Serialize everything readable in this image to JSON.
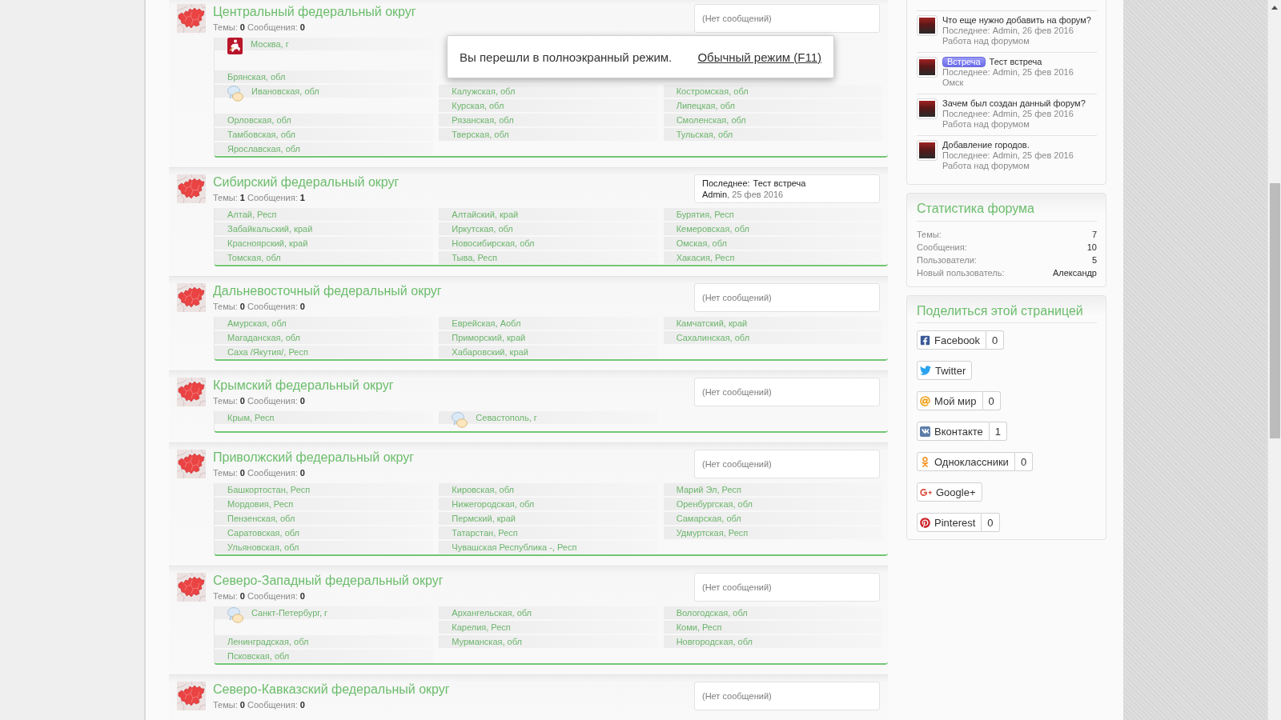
{
  "fullscreen_notice": {
    "text": "Вы перешли в полноэкранный режим.",
    "link": "Обычный режим (F11)"
  },
  "forums": [
    {
      "title": "Центральный федеральный округ",
      "stats": "Темы: **0** Сообщения: **0**",
      "last_post": {
        "kind": "empty",
        "text": "(Нет сообщений)"
      },
      "subforums": [
        {
          "kind": "coat",
          "name": "Москва, г"
        },
        {
          "kind": "covered"
        },
        {
          "kind": "covered"
        },
        {
          "kind": "covered"
        },
        {
          "kind": "covered"
        },
        {
          "kind": "plain",
          "name": "Брянская, обл"
        },
        {
          "kind": "covered"
        },
        {
          "kind": "covered"
        },
        {
          "kind": "bubble",
          "name": "Ивановская, обл"
        },
        {
          "kind": "plain",
          "name": "Калужская, обл"
        },
        {
          "kind": "plain",
          "name": "Костромская, обл"
        },
        {
          "kind": "plain",
          "name": "Курская, обл"
        },
        {
          "kind": "plain",
          "name": "Липецкая, обл"
        },
        {
          "kind": "plain",
          "name": "Орловская, обл"
        },
        {
          "kind": "plain",
          "name": "Рязанская, обл"
        },
        {
          "kind": "plain",
          "name": "Смоленская, обл"
        },
        {
          "kind": "plain",
          "name": "Тамбовская, обл"
        },
        {
          "kind": "plain",
          "name": "Тверская, обл"
        },
        {
          "kind": "plain",
          "name": "Тульская, обл"
        },
        {
          "kind": "plain",
          "name": "Ярославская, обл"
        }
      ]
    },
    {
      "title": "Сибирский федеральный округ",
      "stats": "Темы: **1** Сообщения: **1**",
      "last_post": {
        "kind": "post",
        "label": "Последнее:",
        "topic": "Тест встреча",
        "author": "Admin",
        "date": ", 25 фев 2016"
      },
      "subforums": [
        {
          "kind": "plain",
          "name": "Алтай, Респ"
        },
        {
          "kind": "plain",
          "name": "Алтайский, край"
        },
        {
          "kind": "plain",
          "name": "Бурятия, Респ"
        },
        {
          "kind": "plain",
          "name": "Забайкальский, край"
        },
        {
          "kind": "plain",
          "name": "Иркутская, обл"
        },
        {
          "kind": "plain",
          "name": "Кемеровская, обл"
        },
        {
          "kind": "plain",
          "name": "Красноярский, край"
        },
        {
          "kind": "plain",
          "name": "Новосибирская, обл"
        },
        {
          "kind": "plain",
          "name": "Омская, обл"
        },
        {
          "kind": "plain",
          "name": "Томская, обл"
        },
        {
          "kind": "plain",
          "name": "Тыва, Респ"
        },
        {
          "kind": "plain",
          "name": "Хакасия, Респ"
        }
      ]
    },
    {
      "title": "Дальневосточный федеральный округ",
      "stats": "Темы: **0** Сообщения: **0**",
      "last_post": {
        "kind": "empty",
        "text": "(Нет сообщений)"
      },
      "subforums": [
        {
          "kind": "plain",
          "name": "Амурская, обл"
        },
        {
          "kind": "plain",
          "name": "Еврейская, Аобл"
        },
        {
          "kind": "plain",
          "name": "Камчатский, край"
        },
        {
          "kind": "plain",
          "name": "Магаданская, обл"
        },
        {
          "kind": "plain",
          "name": "Приморский, край"
        },
        {
          "kind": "plain",
          "name": "Сахалинская, обл"
        },
        {
          "kind": "plain",
          "name": "Саха /Якутия/, Респ"
        },
        {
          "kind": "plain",
          "name": "Хабаровский, край"
        }
      ]
    },
    {
      "title": "Крымский федеральный округ",
      "stats": "Темы: **0** Сообщения: **0**",
      "last_post": {
        "kind": "empty",
        "text": "(Нет сообщений)"
      },
      "subforums": [
        {
          "kind": "plain",
          "name": "Крым, Респ"
        },
        {
          "kind": "bubble",
          "name": "Севастополь, г"
        }
      ]
    },
    {
      "title": "Приволжский федеральный округ",
      "stats": "Темы: **0** Сообщения: **0**",
      "last_post": {
        "kind": "empty",
        "text": "(Нет сообщений)"
      },
      "subforums": [
        {
          "kind": "plain",
          "name": "Башкортостан, Респ"
        },
        {
          "kind": "plain",
          "name": "Кировская, обл"
        },
        {
          "kind": "plain",
          "name": "Марий Эл, Респ"
        },
        {
          "kind": "plain",
          "name": "Мордовия, Респ"
        },
        {
          "kind": "plain",
          "name": "Нижегородская, обл"
        },
        {
          "kind": "plain",
          "name": "Оренбургская, обл"
        },
        {
          "kind": "plain",
          "name": "Пензенская, обл"
        },
        {
          "kind": "plain",
          "name": "Пермский, край"
        },
        {
          "kind": "plain",
          "name": "Самарская, обл"
        },
        {
          "kind": "plain",
          "name": "Саратовская, обл"
        },
        {
          "kind": "plain",
          "name": "Татарстан, Респ"
        },
        {
          "kind": "plain",
          "name": "Удмуртская, Респ"
        },
        {
          "kind": "plain",
          "name": "Ульяновская, обл"
        },
        {
          "kind": "plain",
          "name": "Чувашская Республика -, Респ"
        }
      ]
    },
    {
      "title": "Северо-Западный федеральный округ",
      "stats": "Темы: **0** Сообщения: **0**",
      "last_post": {
        "kind": "empty",
        "text": "(Нет сообщений)"
      },
      "subforums": [
        {
          "kind": "bubble",
          "name": "Санкт-Петербург, г"
        },
        {
          "kind": "plain",
          "name": "Архангельская, обл"
        },
        {
          "kind": "plain",
          "name": "Вологодская, обл"
        },
        {
          "kind": "plain",
          "name": "Карелия, Респ"
        },
        {
          "kind": "plain",
          "name": "Коми, Респ"
        },
        {
          "kind": "plain",
          "name": "Ленинградская, обл"
        },
        {
          "kind": "plain",
          "name": "Мурманская, обл"
        },
        {
          "kind": "plain",
          "name": "Новгородская, обл"
        },
        {
          "kind": "plain",
          "name": "Псковская, обл"
        }
      ]
    },
    {
      "title": "Северо-Кавказский федеральный округ",
      "stats": "Темы: **0** Сообщения: **0**",
      "last_post": {
        "kind": "empty",
        "text": "(Нет сообщений)"
      }
    }
  ],
  "recent_topics": [
    {
      "title": "Что еще нужно добавить на форум?",
      "meta": "Последнее: Admin, 26 фев 2016",
      "forum": "Работа над форумом"
    },
    {
      "prefix": "Встреча",
      "title": "Тест встреча",
      "meta": "Последнее: Admin, 25 фев 2016",
      "forum": "Омск"
    },
    {
      "title": "Зачем был создан данный форум?",
      "meta": "Последнее: Admin, 25 фев 2016",
      "forum": "Работа над форумом"
    },
    {
      "title": "Добавление городов.",
      "meta": "Последнее: Admin, 25 фев 2016",
      "forum": "Работа над форумом"
    }
  ],
  "forum_stats": {
    "title": "Статистика форума",
    "rows": [
      {
        "label": "Темы:",
        "value": "7"
      },
      {
        "label": "Сообщения:",
        "value": "10"
      },
      {
        "label": "Пользователи:",
        "value": "5"
      },
      {
        "label": "Новый пользователь:",
        "value": "Александр"
      }
    ]
  },
  "share": {
    "title": "Поделиться этой страницей",
    "buttons": [
      {
        "kind": "facebook",
        "label": "Facebook",
        "count": "0"
      },
      {
        "kind": "twitter",
        "label": "Twitter"
      },
      {
        "kind": "mymir",
        "label": "Мой мир",
        "count": "0"
      },
      {
        "kind": "vkontakte",
        "label": "Вконтакте",
        "count": "1"
      },
      {
        "kind": "odnoklassniki",
        "label": "Одноклассники",
        "count": "0"
      },
      {
        "kind": "googleplus",
        "label": "Google+"
      },
      {
        "kind": "pinterest",
        "label": "Pinterest",
        "count": "0"
      }
    ]
  }
}
